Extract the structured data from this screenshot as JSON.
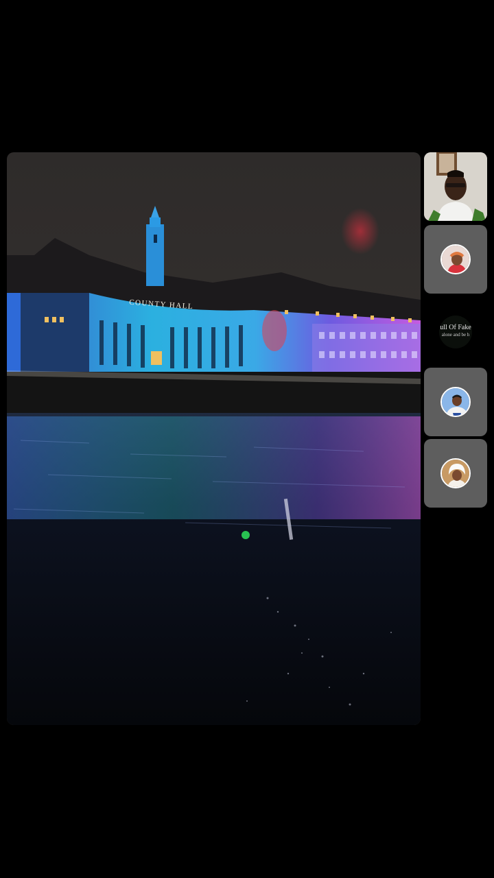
{
  "main_video": {
    "sign_text": "COUNTY HALL"
  },
  "participants": [
    {
      "name": "host-camera",
      "type": "video"
    },
    {
      "name": "participant-2",
      "type": "avatar"
    },
    {
      "name": "participant-3",
      "type": "avatar-text",
      "avatar_text": "ull Of Fake",
      "avatar_subtext": "alone and be h"
    },
    {
      "name": "participant-4",
      "type": "avatar"
    },
    {
      "name": "participant-5",
      "type": "avatar"
    }
  ]
}
